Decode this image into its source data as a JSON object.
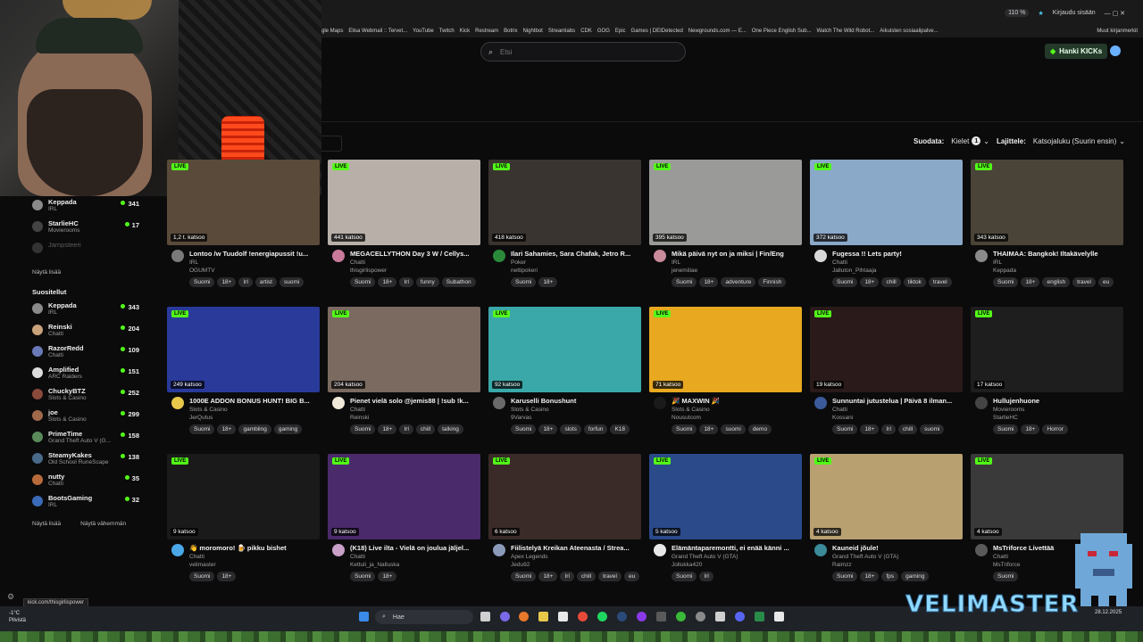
{
  "browser": {
    "zoom": "110 %",
    "signin": "Kirjaudu sisään",
    "bookmarks": [
      "gle Maps",
      "Elisa Webmail :: Tervet...",
      "YouTube",
      "Twitch",
      "Kick",
      "Restream",
      "Botrix",
      "Nightbot",
      "Streamlabs",
      "CDK",
      "GOG",
      "Epic",
      "Games | DEIDetected",
      "Newgrounds.com — E...",
      "One Piece English Sub...",
      "Watch The Wild Robot...",
      "Aikuisten sosiaalipalve..."
    ],
    "other_bookmarks": "Muut kirjanmerkit"
  },
  "header": {
    "search_placeholder": "Etsi",
    "kicks_button": "Hanki KICKs"
  },
  "filters": {
    "filter_label": "Suodata:",
    "languages_label": "Kielet",
    "languages_count": "1",
    "sort_label": "Lajittele:",
    "sort_value": "Katsojaluku (Suurin ensin)"
  },
  "sidebar": {
    "following": [
      {
        "name": "Keppada",
        "category": "IRL",
        "viewers": "341",
        "color": "#8a8a8a"
      },
      {
        "name": "StarlieHC",
        "category": "Movierooms",
        "viewers": "17",
        "color": "#444"
      },
      {
        "name": "Jampsteeri",
        "category": "",
        "viewers": "",
        "color": "#333",
        "offline": true
      }
    ],
    "show_more": "Näytä lisää",
    "recommended_title": "Suositellut",
    "recommended": [
      {
        "name": "Keppada",
        "category": "IRL",
        "viewers": "343",
        "color": "#8a8a8a"
      },
      {
        "name": "Reinski",
        "category": "Chatti",
        "viewers": "204",
        "color": "#c9a27a"
      },
      {
        "name": "RazorRedd",
        "category": "Chatti",
        "viewers": "109",
        "color": "#6a7ab8"
      },
      {
        "name": "Amplified",
        "category": "ARC Raiders",
        "viewers": "151",
        "color": "#dddddd"
      },
      {
        "name": "ChuckyBTZ",
        "category": "Slots & Casino",
        "viewers": "252",
        "color": "#8a4a3a"
      },
      {
        "name": "joe",
        "category": "Slots & Casino",
        "viewers": "299",
        "color": "#a06a4a"
      },
      {
        "name": "PrimeTime",
        "category": "Grand Theft Auto V (G...",
        "viewers": "158",
        "color": "#5a8a5a"
      },
      {
        "name": "SteamyKakes",
        "category": "Old School RuneScape",
        "viewers": "138",
        "color": "#4a6a8a"
      },
      {
        "name": "nutty",
        "category": "Chatti",
        "viewers": "35",
        "color": "#b86a3a"
      },
      {
        "name": "BootsGaming",
        "category": "IRL",
        "viewers": "32",
        "color": "#3a6ab8"
      }
    ],
    "show_more2": "Näytä lisää",
    "show_less": "Näytä vähemmän"
  },
  "streams": [
    {
      "views": "1,2 t. katsoo",
      "title": "Lontoo /w Tuudolf !energiapussit !u...",
      "category": "IRL",
      "channel": "OGUMTV",
      "tags": [
        "Suomi",
        "18+",
        "Irl",
        "artist",
        "suomi"
      ],
      "thumb": "#5a4a3a",
      "avatar": "#7a7a7a"
    },
    {
      "views": "441 katsoo",
      "title": "MEGACELLYTHON Day 3 W / Cellys...",
      "category": "Chatti",
      "channel": "thisgirlispower",
      "tags": [
        "Suomi",
        "18+",
        "Irl",
        "funny",
        "Subathon"
      ],
      "thumb": "#b8b0a8",
      "avatar": "#c97a9a"
    },
    {
      "views": "418 katsoo",
      "title": "Ilari Sahamies, Sara Chafak, Jetro R...",
      "category": "Poker",
      "channel": "nettipokeri",
      "tags": [
        "Suomi",
        "18+"
      ],
      "thumb": "#3a3430",
      "avatar": "#2a8a3a"
    },
    {
      "views": "395 katsoo",
      "title": "Mikä päivä nyt on ja miksi | Fin/Eng",
      "category": "IRL",
      "channel": "jenemiliae",
      "tags": [
        "Suomi",
        "18+",
        "adventure",
        "Finnish"
      ],
      "thumb": "#9a9a98",
      "avatar": "#c98a9a"
    },
    {
      "views": "372 katsoo",
      "title": "Fugessa !! Lets party!",
      "category": "Chatti",
      "channel": "Jalluton_Pihtaaja",
      "tags": [
        "Suomi",
        "18+",
        "chill",
        "tiktok",
        "travel"
      ],
      "thumb": "#8aa8c8",
      "avatar": "#d8d8d8"
    },
    {
      "views": "343 katsoo",
      "title": "THAIMAA: Bangkok! Iltakävelylle",
      "category": "IRL",
      "channel": "Keppada",
      "tags": [
        "Suomi",
        "18+",
        "english",
        "travel",
        "eu"
      ],
      "thumb": "#4a4438",
      "avatar": "#8a8a8a"
    },
    {
      "views": "249 katsoo",
      "title": "1000E ADDON BONUS HUNT! BIG B...",
      "category": "Slots & Casino",
      "channel": "JerQutus",
      "tags": [
        "Suomi",
        "18+",
        "gambling",
        "gaming"
      ],
      "thumb": "#2a3a9a",
      "avatar": "#e8c84a"
    },
    {
      "views": "204 katsoo",
      "title": "Pienet vielä solo @jemis88 | !sub !k...",
      "category": "Chatti",
      "channel": "Reinski",
      "tags": [
        "Suomi",
        "18+",
        "Irl",
        "chill",
        "talking"
      ],
      "thumb": "#7a6a60",
      "avatar": "#f0e8d8"
    },
    {
      "views": "92 katsoo",
      "title": "Karuselli Bonushunt",
      "category": "Slots & Casino",
      "channel": "9Varvas",
      "tags": [
        "Suomi",
        "18+",
        "slots",
        "forfun",
        "K18"
      ],
      "thumb": "#3aa8a8",
      "avatar": "#6a6a6a"
    },
    {
      "views": "71 katsoo",
      "title": "🎉 MAXWIN 🎉",
      "category": "Slots & Casino",
      "channel": "Nousutcom",
      "tags": [
        "Suomi",
        "18+",
        "suomi",
        "demo"
      ],
      "thumb": "#e8a820",
      "avatar": "#1a1a1a"
    },
    {
      "views": "19 katsoo",
      "title": "Sunnuntai jutustelua | Päivä 8 ilman...",
      "category": "Chatti",
      "channel": "Kossani",
      "tags": [
        "Suomi",
        "18+",
        "Irl",
        "chill",
        "suomi"
      ],
      "thumb": "#2a1a1a",
      "avatar": "#3a5a9a"
    },
    {
      "views": "17 katsoo",
      "title": "Hullujenhuone",
      "category": "Movierooms",
      "channel": "StarlieHC",
      "tags": [
        "Suomi",
        "18+",
        "Horror"
      ],
      "thumb": "#1e1e1e",
      "avatar": "#444"
    },
    {
      "views": "9 katsoo",
      "title": "👋 moromoro! 🍺 pikku bishet",
      "category": "Chatti",
      "channel": "velimaster",
      "tags": [
        "Suomi",
        "18+"
      ],
      "thumb": "#1a1a1a",
      "avatar": "#4aa8e8"
    },
    {
      "views": "9 katsoo",
      "title": "(K18) Live ilta - Vielä on joulua jäljel...",
      "category": "Chatti",
      "channel": "Kettuli_ja_Nalluska",
      "tags": [
        "Suomi",
        "18+"
      ],
      "thumb": "#4a2a6a",
      "avatar": "#c8a0c8"
    },
    {
      "views": "6 katsoo",
      "title": "Fiilistelyä Kreikan Ateenasta / Strea...",
      "category": "Apex Legends",
      "channel": "Jedu92",
      "tags": [
        "Suomi",
        "18+",
        "Irl",
        "chill",
        "travel",
        "eu"
      ],
      "thumb": "#3a2a28",
      "avatar": "#8a9ab8"
    },
    {
      "views": "5 katsoo",
      "title": "Elämäntaparemontti, ei enää känni ...",
      "category": "Grand Theft Auto V (GTA)",
      "channel": "Jollukka420",
      "tags": [
        "Suomi",
        "Irl"
      ],
      "thumb": "#2a4a8a",
      "avatar": "#e8e8e8"
    },
    {
      "views": "4 katsoo",
      "title": "Kauneid jõule!",
      "category": "Grand Theft Auto V (GTA)",
      "channel": "Raimzz",
      "tags": [
        "Suomi",
        "18+",
        "fps",
        "gaming"
      ],
      "thumb": "#b8a070",
      "avatar": "#3a8a9a"
    },
    {
      "views": "4 katsoo",
      "title": "MsTriforce Livettää",
      "category": "Chatti",
      "channel": "MsTriforce",
      "tags": [
        "Suomi"
      ],
      "thumb": "#3a3a3a",
      "avatar": "#5a5a5a"
    }
  ],
  "live_badge": "LIVE",
  "status_url": "kick.com/thisgirlispower",
  "taskbar": {
    "weather_temp": "-1°C",
    "weather_desc": "Pilvistä",
    "search": "Hae",
    "date": "28.12.2025"
  },
  "overlay_text": "VELIMASTER"
}
